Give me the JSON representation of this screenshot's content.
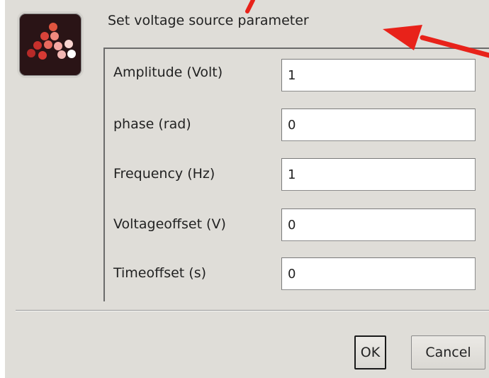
{
  "dialog": {
    "title": "Set voltage source parameter",
    "icon": "app-logo-icon"
  },
  "fields": [
    {
      "label": "Amplitude (Volt)",
      "value": "1"
    },
    {
      "label": "phase (rad)",
      "value": "0"
    },
    {
      "label": "Frequency (Hz)",
      "value": "1"
    },
    {
      "label": "Voltageoffset (V)",
      "value": "0"
    },
    {
      "label": "Timeoffset (s)",
      "value": "0"
    }
  ],
  "buttons": {
    "ok": "OK",
    "cancel": "Cancel"
  },
  "colors": {
    "background": "#dfddd8",
    "annotation_arrow": "#e8221a"
  }
}
